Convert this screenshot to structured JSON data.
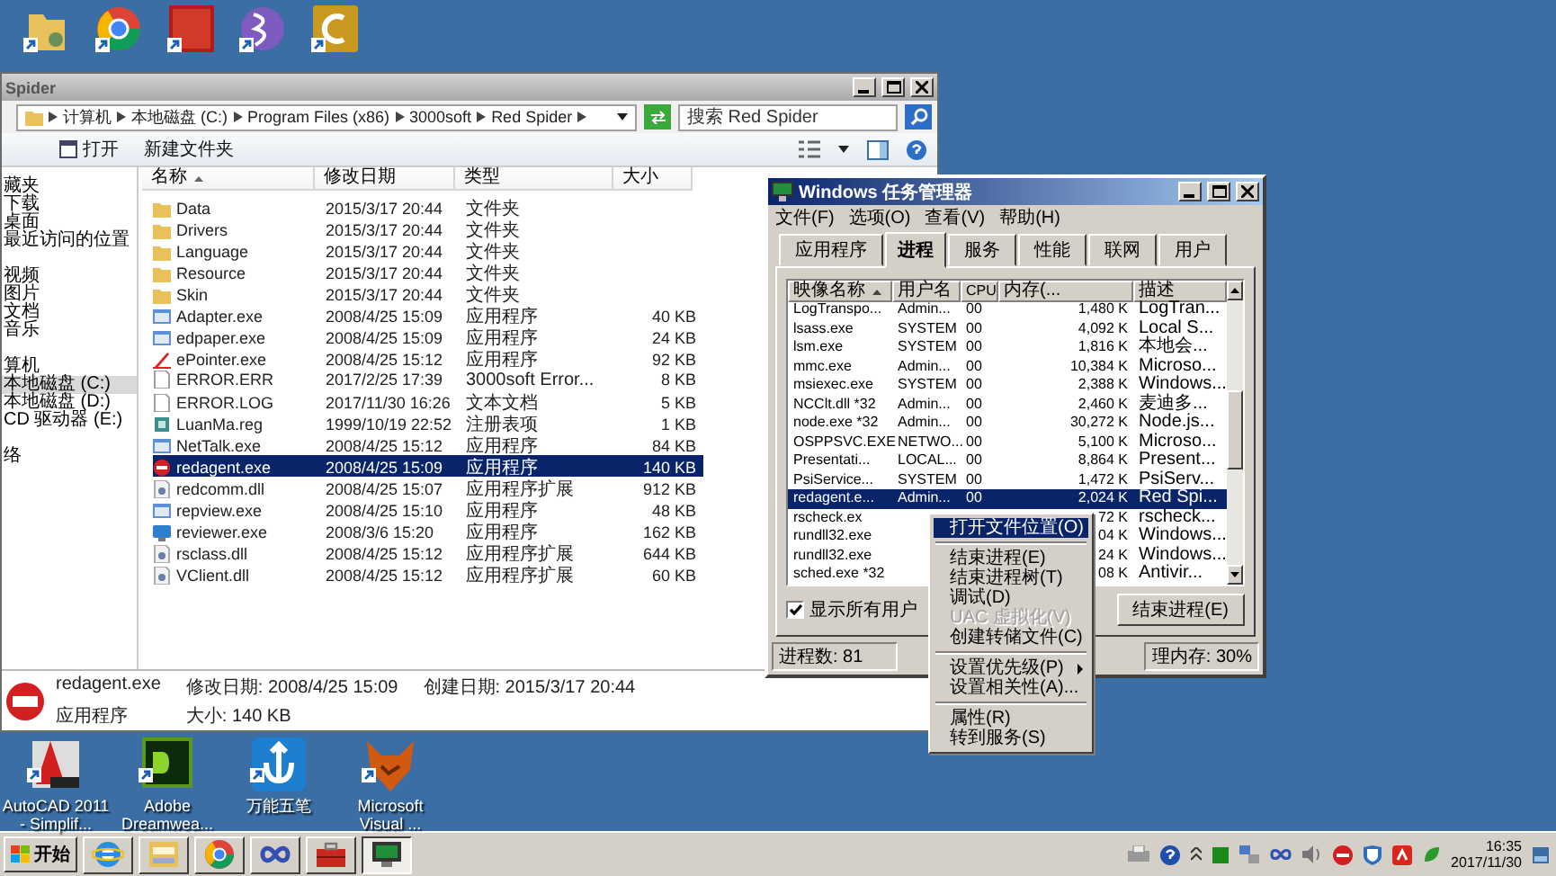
{
  "explorer": {
    "title": "Spider",
    "breadcrumb": [
      "计算机",
      "本地磁盘 (C:)",
      "Program Files (x86)",
      "3000soft",
      "Red Spider"
    ],
    "search": {
      "placeholder": "搜索 Red Spider"
    },
    "toolbar": [
      "打开",
      "新建文件夹"
    ],
    "sidebar": [
      {
        "items": [
          {
            "label": "藏夹",
            "selected": false
          },
          {
            "label": "下载",
            "selected": false
          },
          {
            "label": "桌面",
            "selected": false
          },
          {
            "label": "最近访问的位置",
            "selected": false
          }
        ]
      },
      {
        "items": [
          {
            "label": "视频",
            "selected": false
          },
          {
            "label": "图片",
            "selected": false
          },
          {
            "label": "文档",
            "selected": false
          },
          {
            "label": "音乐",
            "selected": false
          }
        ]
      },
      {
        "items": [
          {
            "label": "算机",
            "selected": false
          },
          {
            "label": "本地磁盘 (C:)",
            "selected": true
          },
          {
            "label": "本地磁盘 (D:)",
            "selected": false
          },
          {
            "label": "CD 驱动器 (E:)",
            "selected": false
          }
        ]
      },
      {
        "items": [
          {
            "label": "络",
            "selected": false
          }
        ]
      }
    ],
    "columns": [
      "名称",
      "修改日期",
      "类型",
      "大小"
    ],
    "files": [
      {
        "name": "Data",
        "date": "2015/3/17 20:44",
        "type": "文件夹",
        "kind": "folder",
        "selected": false
      },
      {
        "name": "Drivers",
        "date": "2015/3/17 20:44",
        "type": "文件夹",
        "kind": "folder",
        "selected": false
      },
      {
        "name": "Language",
        "date": "2015/3/17 20:44",
        "type": "文件夹",
        "kind": "folder",
        "selected": false
      },
      {
        "name": "Resource",
        "date": "2015/3/17 20:44",
        "type": "文件夹",
        "kind": "folder",
        "selected": false
      },
      {
        "name": "Skin",
        "date": "2015/3/17 20:44",
        "type": "文件夹",
        "kind": "folder",
        "selected": false
      },
      {
        "name": "Adapter.exe",
        "date": "2008/4/25 15:09",
        "type": "应用程序",
        "size": "40 KB",
        "kind": "program",
        "selected": false
      },
      {
        "name": "edpaper.exe",
        "date": "2008/4/25 15:09",
        "type": "应用程序",
        "size": "24 KB",
        "kind": "program",
        "selected": false
      },
      {
        "name": "ePointer.exe",
        "date": "2008/4/25 15:12",
        "type": "应用程序",
        "size": "92 KB",
        "kind": "pen",
        "selected": false
      },
      {
        "name": "ERROR.ERR",
        "date": "2017/2/25 17:39",
        "type": "3000soft Error...",
        "size": "8 KB",
        "kind": "document",
        "selected": false
      },
      {
        "name": "ERROR.LOG",
        "date": "2017/11/30 16:26",
        "type": "文本文档",
        "size": "5 KB",
        "kind": "document",
        "selected": false
      },
      {
        "name": "LuanMa.reg",
        "date": "1999/10/19 22:52",
        "type": "注册表项",
        "size": "1 KB",
        "kind": "registry",
        "selected": false
      },
      {
        "name": "NetTalk.exe",
        "date": "2008/4/25 15:12",
        "type": "应用程序",
        "size": "84 KB",
        "kind": "program",
        "selected": false
      },
      {
        "name": "redagent.exe",
        "date": "2008/4/25 15:09",
        "type": "应用程序",
        "size": "140 KB",
        "kind": "blocked",
        "selected": true
      },
      {
        "name": "redcomm.dll",
        "date": "2008/4/25 15:07",
        "type": "应用程序扩展",
        "size": "912 KB",
        "kind": "library",
        "selected": false
      },
      {
        "name": "repview.exe",
        "date": "2008/4/25 15:10",
        "type": "应用程序",
        "size": "48 KB",
        "kind": "program",
        "selected": false
      },
      {
        "name": "reviewer.exe",
        "date": "2008/3/6 15:20",
        "type": "应用程序",
        "size": "162 KB",
        "kind": "screen",
        "selected": false
      },
      {
        "name": "rsclass.dll",
        "date": "2008/4/25 15:12",
        "type": "应用程序扩展",
        "size": "644 KB",
        "kind": "library",
        "selected": false
      },
      {
        "name": "VClient.dll",
        "date": "2008/4/25 15:12",
        "type": "应用程序扩展",
        "size": "60 KB",
        "kind": "library",
        "selected": false
      }
    ],
    "details": {
      "name": "redagent.exe",
      "modified": "修改日期: 2008/4/25 15:09",
      "created": "创建日期: 2015/3/17 20:44",
      "type": "应用程序",
      "size": "大小: 140 KB"
    }
  },
  "task_manager": {
    "title": "Windows 任务管理器",
    "menu": [
      "文件(F)",
      "选项(O)",
      "查看(V)",
      "帮助(H)"
    ],
    "tabs": [
      {
        "label": "应用程序",
        "selected": false
      },
      {
        "label": "进程",
        "selected": true
      },
      {
        "label": "服务",
        "selected": false
      },
      {
        "label": "性能",
        "selected": false
      },
      {
        "label": "联网",
        "selected": false
      },
      {
        "label": "用户",
        "selected": false
      }
    ],
    "columns": [
      "映像名称",
      "用户名",
      "CPU",
      "内存(...",
      "描述"
    ],
    "rows": [
      {
        "name": "LogTranspo...",
        "user": "Admin...",
        "cpu": "00",
        "memory": "1,480 K",
        "description": "LogTran...",
        "selected": false
      },
      {
        "name": "lsass.exe",
        "user": "SYSTEM",
        "cpu": "00",
        "memory": "4,092 K",
        "description": "Local S...",
        "selected": false
      },
      {
        "name": "lsm.exe",
        "user": "SYSTEM",
        "cpu": "00",
        "memory": "1,816 K",
        "description": "本地会...",
        "selected": false
      },
      {
        "name": "mmc.exe",
        "user": "Admin...",
        "cpu": "00",
        "memory": "10,384 K",
        "description": "Microso...",
        "selected": false
      },
      {
        "name": "msiexec.exe",
        "user": "SYSTEM",
        "cpu": "00",
        "memory": "2,388 K",
        "description": "Windows...",
        "selected": false
      },
      {
        "name": "NCClt.dll *32",
        "user": "Admin...",
        "cpu": "00",
        "memory": "2,460 K",
        "description": "麦迪多...",
        "selected": false
      },
      {
        "name": "node.exe *32",
        "user": "Admin...",
        "cpu": "00",
        "memory": "30,272 K",
        "description": "Node.js...",
        "selected": false
      },
      {
        "name": "OSPPSVC.EXE",
        "user": "NETWO...",
        "cpu": "00",
        "memory": "5,100 K",
        "description": "Microso...",
        "selected": false
      },
      {
        "name": "Presentati...",
        "user": "LOCAL...",
        "cpu": "00",
        "memory": "8,864 K",
        "description": "Present...",
        "selected": false
      },
      {
        "name": "PsiService...",
        "user": "SYSTEM",
        "cpu": "00",
        "memory": "1,472 K",
        "description": "PsiServ...",
        "selected": false
      },
      {
        "name": "redagent.e...",
        "user": "Admin...",
        "cpu": "00",
        "memory": "2,024 K",
        "description": "Red Spi...",
        "selected": true
      },
      {
        "name": "rscheck.ex",
        "memory": "72 K",
        "description": "rscheck...",
        "selected": false
      },
      {
        "name": "rundll32.exe",
        "memory": "04 K",
        "description": "Windows...",
        "selected": false
      },
      {
        "name": "rundll32.exe",
        "memory": "24 K",
        "description": "Windows...",
        "selected": false
      },
      {
        "name": "sched.exe *32",
        "memory": "08 K",
        "description": "Antivir...",
        "selected": false
      }
    ],
    "show_all_users": {
      "label": "显示所有用户",
      "checked": true
    },
    "end_button": "结束进程(E)",
    "status": [
      "进程数: 81",
      "理内存: 30%"
    ],
    "context_menu": [
      {
        "kind": "item",
        "label": "打开文件位置(O)",
        "selected": true,
        "disabled": false
      },
      {
        "kind": "separator"
      },
      {
        "kind": "item",
        "label": "结束进程(E)",
        "selected": false,
        "disabled": false
      },
      {
        "kind": "item",
        "label": "结束进程树(T)",
        "selected": false,
        "disabled": false
      },
      {
        "kind": "item",
        "label": "调试(D)",
        "selected": false,
        "disabled": false
      },
      {
        "kind": "item",
        "label": "UAC 虚拟化(V)",
        "selected": false,
        "disabled": true
      },
      {
        "kind": "item",
        "label": "创建转储文件(C)",
        "selected": false,
        "disabled": false
      },
      {
        "kind": "separator"
      },
      {
        "kind": "submenu",
        "label": "设置优先级(P)",
        "selected": false,
        "disabled": false
      },
      {
        "kind": "item",
        "label": "设置相关性(A)...",
        "selected": false,
        "disabled": false
      },
      {
        "kind": "separator"
      },
      {
        "kind": "item",
        "label": "属性(R)",
        "selected": false,
        "disabled": false
      },
      {
        "kind": "item",
        "label": "转到服务(S)",
        "selected": false,
        "disabled": false
      }
    ]
  },
  "desktop_icons": [
    {
      "label": "AutoCAD 2011\n- Simplif..."
    },
    {
      "label": "Adobe\nDreamwea..."
    },
    {
      "label": "万能五笔"
    },
    {
      "label": "Microsoft\nVisual ..."
    }
  ],
  "taskbar": {
    "start": "开始",
    "buttons": [
      {
        "selected": false
      },
      {
        "selected": false
      },
      {
        "selected": false
      },
      {
        "selected": false
      },
      {
        "selected": false
      },
      {
        "selected": true
      }
    ],
    "time": "16:35",
    "date": "2017/11/30"
  }
}
